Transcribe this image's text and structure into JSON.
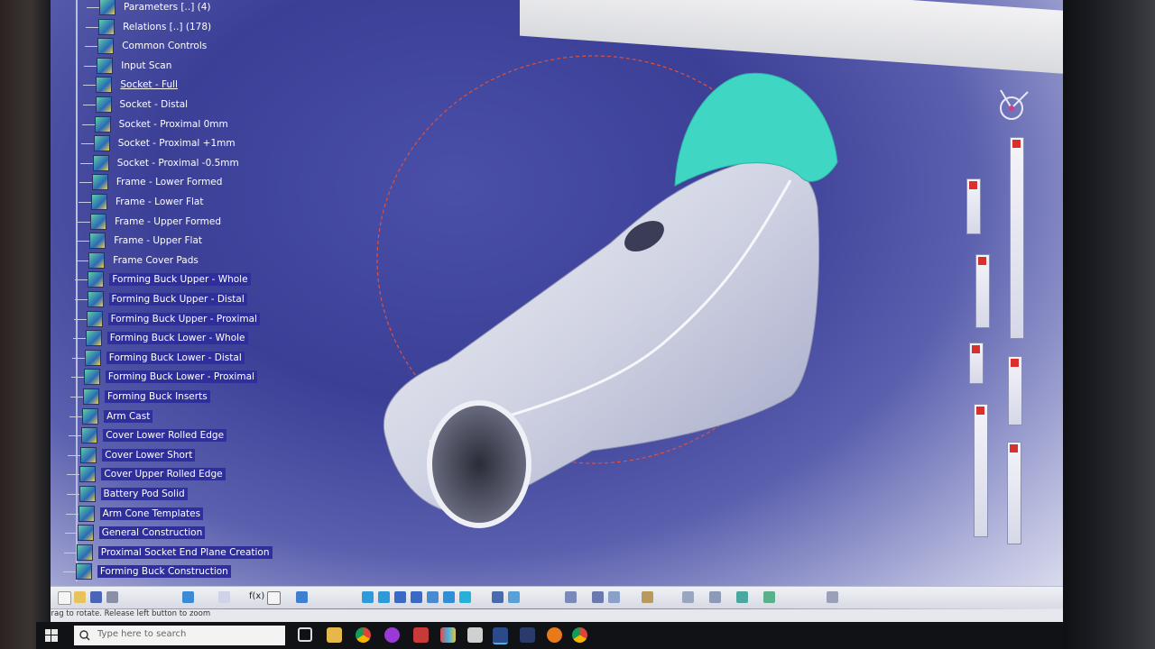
{
  "tree": {
    "items": [
      {
        "label": "Parameters [..] (4)"
      },
      {
        "label": "Relations [..] (178)"
      },
      {
        "label": "Common Controls"
      },
      {
        "label": "Input Scan"
      },
      {
        "label": "Socket - Full"
      },
      {
        "label": "Socket - Distal"
      },
      {
        "label": "Socket - Proximal 0mm"
      },
      {
        "label": "Socket - Proximal +1mm"
      },
      {
        "label": "Socket - Proximal -0.5mm"
      },
      {
        "label": "Frame - Lower Formed"
      },
      {
        "label": "Frame - Lower Flat"
      },
      {
        "label": "Frame - Upper Formed"
      },
      {
        "label": "Frame - Upper Flat"
      },
      {
        "label": "Frame Cover Pads"
      },
      {
        "label": "Forming Buck Upper - Whole"
      },
      {
        "label": "Forming Buck Upper - Distal"
      },
      {
        "label": "Forming Buck Upper - Proximal"
      },
      {
        "label": "Forming Buck Lower - Whole"
      },
      {
        "label": "Forming Buck Lower - Distal"
      },
      {
        "label": "Forming Buck Lower - Proximal"
      },
      {
        "label": "Forming Buck Inserts"
      },
      {
        "label": "Arm Cast"
      },
      {
        "label": "Cover Lower Rolled Edge"
      },
      {
        "label": "Cover Lower Short"
      },
      {
        "label": "Cover Upper Rolled Edge"
      },
      {
        "label": "Battery Pod Solid"
      },
      {
        "label": "Arm Cone Templates"
      },
      {
        "label": "General Construction"
      },
      {
        "label": "Proximal Socket End Plane Creation"
      },
      {
        "label": "Forming Buck Construction"
      }
    ]
  },
  "toolbar": {
    "formula_label": "f(x)"
  },
  "statusbar": {
    "text": "Drag to rotate. Release left button to zoom"
  },
  "taskbar": {
    "search_placeholder": "Type here to search"
  },
  "colors": {
    "selection": "#2f2f9c",
    "model_body": "#d9dbe8",
    "model_cap": "#3fd6c4",
    "rotation_circle": "#e0503c",
    "background_top": "#3b3f96",
    "background_bottom": "#e6e7f3"
  },
  "icons": [
    "tree-node-icon",
    "compass-icon",
    "windows-start-icon",
    "search-icon",
    "task-view-icon",
    "file-explorer-icon",
    "chrome-icon",
    "app-icon"
  ]
}
